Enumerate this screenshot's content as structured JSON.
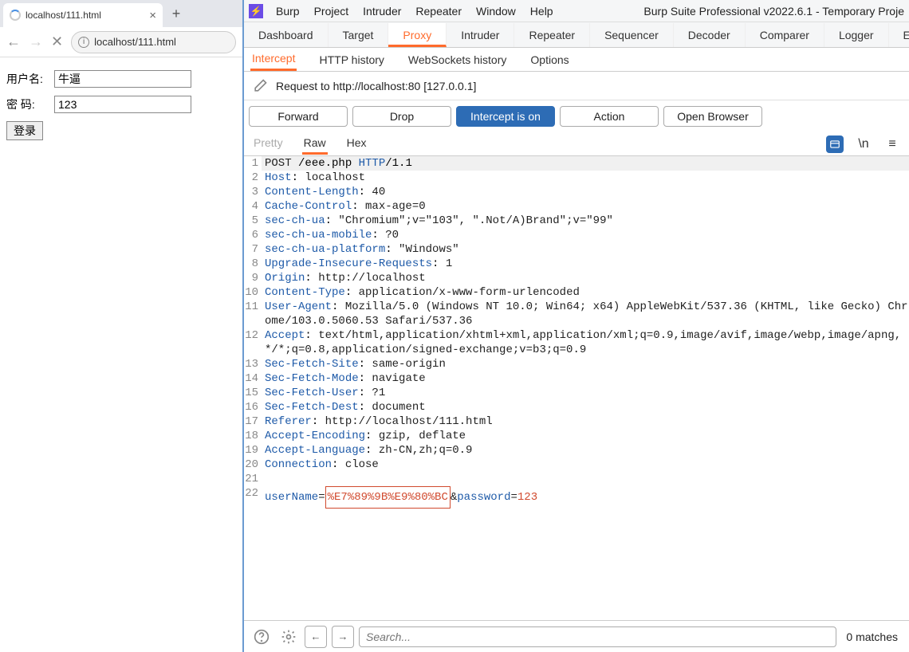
{
  "browser": {
    "tab_title": "localhost/111.html",
    "url_text": "localhost/111.html",
    "form": {
      "username_label": "用户名:",
      "username_value": "牛逼",
      "password_label": "密 码:",
      "password_value": "123",
      "login_label": "登录"
    }
  },
  "burp": {
    "menu": [
      "Burp",
      "Project",
      "Intruder",
      "Repeater",
      "Window",
      "Help"
    ],
    "window_title": "Burp Suite Professional v2022.6.1 - Temporary Proje",
    "tabs1": [
      "Dashboard",
      "Target",
      "Proxy",
      "Intruder",
      "Repeater",
      "Sequencer",
      "Decoder",
      "Comparer",
      "Logger",
      "Exte"
    ],
    "tabs1_active": 2,
    "tabs2": [
      "Intercept",
      "HTTP history",
      "WebSockets history",
      "Options"
    ],
    "tabs2_active": 0,
    "request_info": "Request to http://localhost:80  [127.0.0.1]",
    "actions": {
      "forward": "Forward",
      "drop": "Drop",
      "intercept": "Intercept is on",
      "action": "Action",
      "open_browser": "Open Browser"
    },
    "view_tabs": [
      "Pretty",
      "Raw",
      "Hex"
    ],
    "view_tabs_active": 1,
    "lines": [
      {
        "n": 1,
        "type": "req",
        "method": "POST",
        "path": " /eee.php ",
        "proto": "HTTP",
        "ver": "/1.1"
      },
      {
        "n": 2,
        "type": "h",
        "k": "Host",
        "v": " localhost"
      },
      {
        "n": 3,
        "type": "h",
        "k": "Content-Length",
        "v": " 40"
      },
      {
        "n": 4,
        "type": "h",
        "k": "Cache-Control",
        "v": " max-age=0"
      },
      {
        "n": 5,
        "type": "h",
        "k": "sec-ch-ua",
        "v": " \"Chromium\";v=\"103\", \".Not/A)Brand\";v=\"99\""
      },
      {
        "n": 6,
        "type": "h",
        "k": "sec-ch-ua-mobile",
        "v": " ?0"
      },
      {
        "n": 7,
        "type": "h",
        "k": "sec-ch-ua-platform",
        "v": " \"Windows\""
      },
      {
        "n": 8,
        "type": "h",
        "k": "Upgrade-Insecure-Requests",
        "v": " 1"
      },
      {
        "n": 9,
        "type": "h",
        "k": "Origin",
        "v": " http://localhost"
      },
      {
        "n": 10,
        "type": "h",
        "k": "Content-Type",
        "v": " application/x-www-form-urlencoded"
      },
      {
        "n": 11,
        "type": "h",
        "k": "User-Agent",
        "v": " Mozilla/5.0 (Windows NT 10.0; Win64; x64) AppleWebKit/537.36 (KHTML, like Gecko) Chrome/103.0.5060.53 Safari/537.36"
      },
      {
        "n": 12,
        "type": "h",
        "k": "Accept",
        "v": " text/html,application/xhtml+xml,application/xml;q=0.9,image/avif,image/webp,image/apng,*/*;q=0.8,application/signed-exchange;v=b3;q=0.9"
      },
      {
        "n": 13,
        "type": "h",
        "k": "Sec-Fetch-Site",
        "v": " same-origin"
      },
      {
        "n": 14,
        "type": "h",
        "k": "Sec-Fetch-Mode",
        "v": " navigate"
      },
      {
        "n": 15,
        "type": "h",
        "k": "Sec-Fetch-User",
        "v": " ?1"
      },
      {
        "n": 16,
        "type": "h",
        "k": "Sec-Fetch-Dest",
        "v": " document"
      },
      {
        "n": 17,
        "type": "h",
        "k": "Referer",
        "v": " http://localhost/111.html"
      },
      {
        "n": 18,
        "type": "h",
        "k": "Accept-Encoding",
        "v": " gzip, deflate"
      },
      {
        "n": 19,
        "type": "h",
        "k": "Accept-Language",
        "v": " zh-CN,zh;q=0.9"
      },
      {
        "n": 20,
        "type": "h",
        "k": "Connection",
        "v": " close"
      },
      {
        "n": 21,
        "type": "blank"
      },
      {
        "n": 22,
        "type": "body",
        "p1": "userName",
        "v1": "%E7%89%9B%E9%80%BC",
        "p2": "password",
        "v2": "123"
      }
    ],
    "search_placeholder": "Search...",
    "matches_text": "0 matches",
    "newline_symbol": "\\n",
    "hamburger": "≡"
  }
}
